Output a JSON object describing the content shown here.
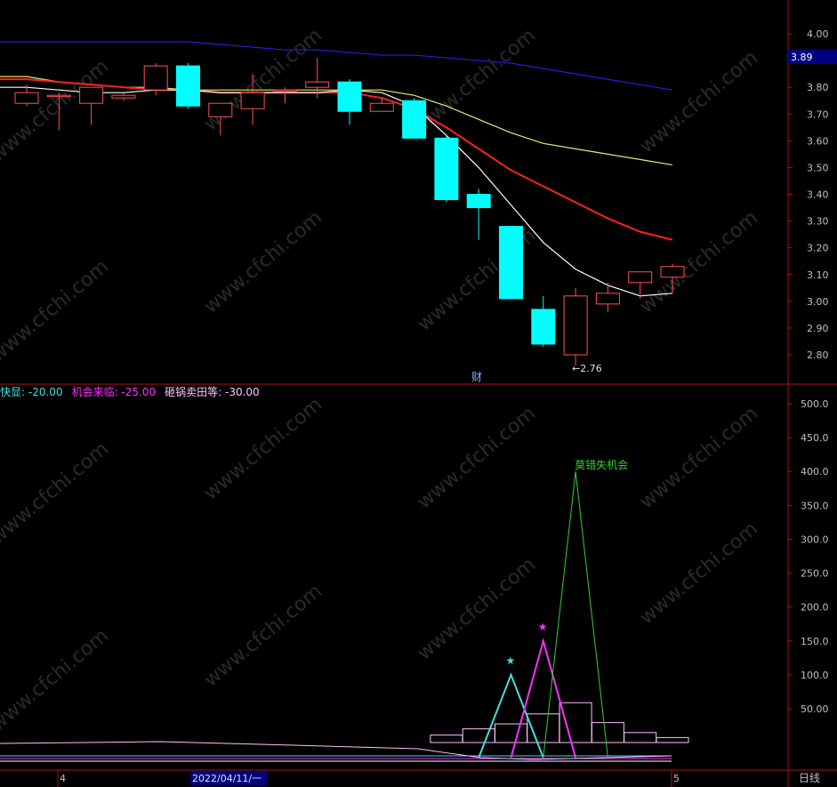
{
  "colors": {
    "background": "#000000",
    "frame": "#b01010",
    "axis_text": "#c0c0c0",
    "candle_up": "#ff5050",
    "candle_down": "#00ffff",
    "ma_white": "#ffffff",
    "ma_yellow": "#e8e870",
    "ma_red": "#ff2020",
    "ma_blue": "#2020e0",
    "price_badge": "#000080",
    "ind_cyan": "#40e0e0",
    "ind_magenta": "#ff30ff",
    "ind_green": "#30d030",
    "ind_pink": "#ffc0ff",
    "watermark": "#2a2a2a"
  },
  "watermark": "www.cfchi.com",
  "chart_data": [
    {
      "type": "candlestick",
      "ylim": [
        2.75,
        4.05
      ],
      "yticks": [
        "4.00",
        "3.90",
        "3.80",
        "3.70",
        "3.60",
        "3.50",
        "3.40",
        "3.30",
        "3.20",
        "3.10",
        "3.00",
        "2.90",
        "2.80"
      ],
      "current_price_label": "3.89",
      "low_marker": "←2.76",
      "event_marker": "财",
      "candles": [
        {
          "o": 3.74,
          "h": 3.81,
          "l": 3.73,
          "c": 3.78
        },
        {
          "o": 3.77,
          "h": 3.78,
          "l": 3.64,
          "c": 3.77
        },
        {
          "o": 3.74,
          "h": 3.8,
          "l": 3.66,
          "c": 3.8
        },
        {
          "o": 3.76,
          "h": 3.78,
          "l": 3.75,
          "c": 3.77
        },
        {
          "o": 3.79,
          "h": 3.89,
          "l": 3.77,
          "c": 3.88
        },
        {
          "o": 3.88,
          "h": 3.89,
          "l": 3.72,
          "c": 3.73
        },
        {
          "o": 3.69,
          "h": 3.74,
          "l": 3.62,
          "c": 3.74
        },
        {
          "o": 3.72,
          "h": 3.85,
          "l": 3.66,
          "c": 3.78
        },
        {
          "o": 3.79,
          "h": 3.8,
          "l": 3.74,
          "c": 3.79
        },
        {
          "o": 3.8,
          "h": 3.91,
          "l": 3.76,
          "c": 3.82
        },
        {
          "o": 3.82,
          "h": 3.83,
          "l": 3.66,
          "c": 3.71
        },
        {
          "o": 3.71,
          "h": 3.76,
          "l": 3.71,
          "c": 3.74
        },
        {
          "o": 3.75,
          "h": 3.76,
          "l": 3.61,
          "c": 3.61
        },
        {
          "o": 3.61,
          "h": 3.62,
          "l": 3.37,
          "c": 3.38
        },
        {
          "o": 3.4,
          "h": 3.42,
          "l": 3.23,
          "c": 3.35
        },
        {
          "o": 3.28,
          "h": 3.28,
          "l": 3.01,
          "c": 3.01
        },
        {
          "o": 2.97,
          "h": 3.02,
          "l": 2.83,
          "c": 2.84
        },
        {
          "o": 2.8,
          "h": 3.05,
          "l": 2.76,
          "c": 3.02
        },
        {
          "o": 2.99,
          "h": 3.07,
          "l": 2.96,
          "c": 3.03
        },
        {
          "o": 3.07,
          "h": 3.11,
          "l": 3.01,
          "c": 3.11
        },
        {
          "o": 3.09,
          "h": 3.14,
          "l": 3.03,
          "c": 3.13
        }
      ],
      "moving_averages": [
        {
          "color_key": "ma_blue",
          "values": [
            3.97,
            3.97,
            3.97,
            3.97,
            3.97,
            3.97,
            3.96,
            3.95,
            3.94,
            3.94,
            3.93,
            3.92,
            3.92,
            3.91,
            3.9,
            3.89,
            3.87,
            3.85,
            3.83,
            3.81,
            3.79
          ]
        },
        {
          "color_key": "ma_yellow",
          "values": [
            3.84,
            3.82,
            3.81,
            3.8,
            3.8,
            3.79,
            3.79,
            3.79,
            3.79,
            3.79,
            3.79,
            3.79,
            3.77,
            3.73,
            3.68,
            3.63,
            3.59,
            3.57,
            3.55,
            3.53,
            3.51
          ]
        },
        {
          "color_key": "ma_red",
          "values": [
            3.83,
            3.82,
            3.81,
            3.8,
            3.79,
            3.79,
            3.78,
            3.78,
            3.78,
            3.78,
            3.78,
            3.76,
            3.72,
            3.65,
            3.57,
            3.49,
            3.43,
            3.37,
            3.31,
            3.26,
            3.23
          ]
        },
        {
          "color_key": "ma_white",
          "values": [
            3.8,
            3.79,
            3.78,
            3.78,
            3.79,
            3.79,
            3.78,
            3.78,
            3.78,
            3.78,
            3.79,
            3.78,
            3.73,
            3.62,
            3.5,
            3.36,
            3.22,
            3.12,
            3.06,
            3.02,
            3.03
          ]
        }
      ]
    },
    {
      "type": "line",
      "ylim": [
        0,
        540
      ],
      "yticks": [
        "500.0",
        "450.0",
        "400.0",
        "350.0",
        "300.0",
        "250.0",
        "200.0",
        "150.0",
        "100.0",
        "50.00"
      ],
      "legend": [
        {
          "name": "都快显",
          "value": "-20.00",
          "color_key": "ind_cyan"
        },
        {
          "name": "机会来临",
          "value": "-25.00",
          "color_key": "ind_magenta"
        },
        {
          "name": "砸锅卖田等",
          "value": "-30.00",
          "color_key": "ind_pink"
        }
      ],
      "annotation": "莫错失机会",
      "stars": [
        "★",
        "★"
      ],
      "series": [
        {
          "color_key": "ind_cyan",
          "values": [
            0,
            0,
            0,
            0,
            0,
            0,
            0,
            0,
            0,
            0,
            0,
            0,
            0,
            0,
            0,
            100,
            0,
            0,
            0,
            0,
            0
          ]
        },
        {
          "color_key": "ind_magenta",
          "values": [
            0,
            0,
            0,
            0,
            0,
            0,
            0,
            0,
            0,
            0,
            0,
            0,
            0,
            0,
            0,
            0,
            150,
            0,
            0,
            0,
            0
          ]
        },
        {
          "color_key": "ind_green",
          "values": [
            0,
            0,
            0,
            0,
            0,
            0,
            0,
            0,
            0,
            0,
            0,
            0,
            0,
            0,
            0,
            0,
            0,
            400,
            0,
            0,
            0
          ]
        }
      ],
      "bars": [
        {
          "i": 13,
          "v": 12
        },
        {
          "i": 14,
          "v": 22
        },
        {
          "i": 15,
          "v": 30
        },
        {
          "i": 16,
          "v": 46
        },
        {
          "i": 17,
          "v": 64
        },
        {
          "i": 18,
          "v": 32
        },
        {
          "i": 19,
          "v": 16
        },
        {
          "i": 20,
          "v": 8
        }
      ]
    }
  ],
  "date_axis": {
    "left_tick": "4",
    "date": "2022/04/11/一",
    "right_tick": "5",
    "period": "日线"
  }
}
